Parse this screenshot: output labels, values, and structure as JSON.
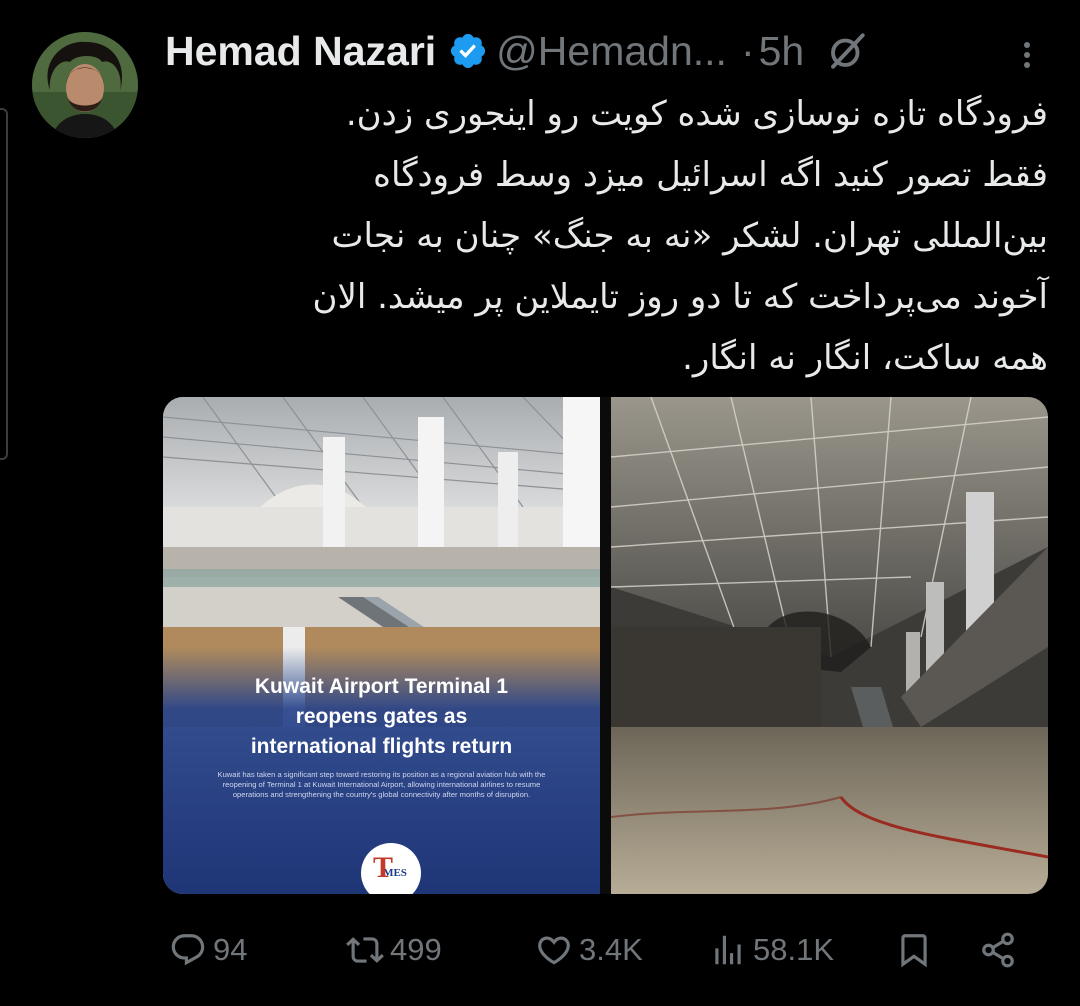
{
  "author": {
    "name": "Hemad Nazari",
    "handle": "@Hemadn...",
    "separator": "·",
    "time": "5h"
  },
  "tweet": {
    "lines": [
      "فرودگاه تازه نوسازی شده کویت رو اینجوری زدن.",
      "فقط تصور کنید اگه اسرائیل میزد وسط فرودگاه",
      "بین‌المللی تهران. لشکر «نه به جنگ» چنان به نجات",
      "آخوند می‌پرداخت که تا دو روز تایملاین پر میشد. الان",
      "همه ساکت، انگار نه انگار."
    ]
  },
  "media": {
    "news_headline": "Kuwait Airport Terminal 1\nreopens gates as\ninternational flights return",
    "news_body": "Kuwait has taken a significant step toward restoring its position as a regional aviation hub with the reopening of Terminal 1 at Kuwait International Airport, allowing international airlines to resume operations and strengthening the country's global connectivity after months of disruption.",
    "news_logo": "MES"
  },
  "actions": {
    "replies": "94",
    "reposts": "499",
    "likes": "3.4K",
    "views": "58.1K"
  },
  "icons": [
    "verified-badge-icon",
    "grok-icon",
    "more-options-icon",
    "reply-icon",
    "repost-icon",
    "like-icon",
    "views-icon",
    "bookmark-icon",
    "share-icon"
  ],
  "colors": {
    "background": "#000000",
    "text": "#e7e9ea",
    "secondary": "#71767b",
    "verified": "#1d9bf0"
  }
}
